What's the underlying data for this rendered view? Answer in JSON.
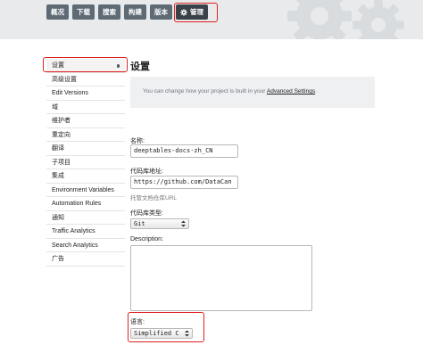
{
  "nav": {
    "tabs": [
      {
        "label": "概况"
      },
      {
        "label": "下载"
      },
      {
        "label": "搜索"
      },
      {
        "label": "构建"
      },
      {
        "label": "版本"
      },
      {
        "label": "管理",
        "icon": "gear-icon",
        "active": true
      }
    ]
  },
  "sidebar": {
    "items": [
      {
        "label": "设置",
        "active": true
      },
      {
        "label": "高级设置"
      },
      {
        "label": "Edit Versions"
      },
      {
        "label": "域"
      },
      {
        "label": "维护者"
      },
      {
        "label": "重定向"
      },
      {
        "label": "翻译"
      },
      {
        "label": "子项目"
      },
      {
        "label": "集成"
      },
      {
        "label": "Environment Variables"
      },
      {
        "label": "Automation Rules"
      },
      {
        "label": "通知"
      },
      {
        "label": "Traffic Analytics"
      },
      {
        "label": "Search Analytics"
      },
      {
        "label": "广告"
      }
    ]
  },
  "main": {
    "title": "设置",
    "notice": {
      "text": "You can change how your project is built in your ",
      "link": "Advanced Settings",
      "suffix": "."
    },
    "form": {
      "name": {
        "label": "名称:",
        "value": "deeptables-docs-zh_CN"
      },
      "repo_url": {
        "label": "代码库地址:",
        "value": "https://github.com/DataCan",
        "help": "托管文档仓库URL"
      },
      "repo_type": {
        "label": "代码库类型:",
        "value": "Git"
      },
      "description": {
        "label": "Description:",
        "value": ""
      },
      "language": {
        "label": "语言:",
        "value": "Simplified C"
      }
    }
  },
  "colors": {
    "highlight": "#e02020",
    "tab_bg": "#5f6b74",
    "tab_active_bg": "#3a4148",
    "topbar_bg": "#e8eaec"
  }
}
